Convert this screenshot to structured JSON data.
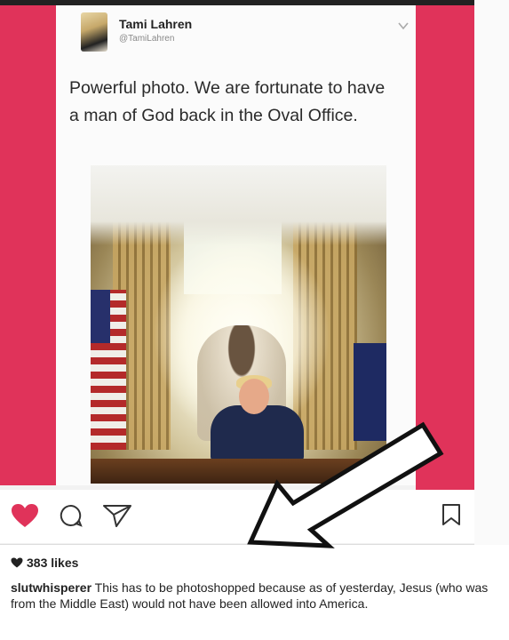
{
  "tweet": {
    "author_name": "Tami Lahren",
    "author_handle": "@TamiLahren",
    "text": "Powerful photo. We are fortunate to have a man of God back in the Oval Office.",
    "menu_icon": "chevron-down-icon"
  },
  "post": {
    "actions": {
      "like_icon": "heart-icon",
      "comment_icon": "comment-icon",
      "share_icon": "send-icon",
      "save_icon": "bookmark-icon",
      "like_color": "#e0335a"
    },
    "likes": "383 likes",
    "caption_user": "slutwhisperer",
    "caption_text": "This has to be photoshopped because as of yesterday, Jesus (who was from the Middle East) would not have been allowed into America."
  },
  "colors": {
    "accent_pink": "#e0335a",
    "text": "#222222"
  }
}
